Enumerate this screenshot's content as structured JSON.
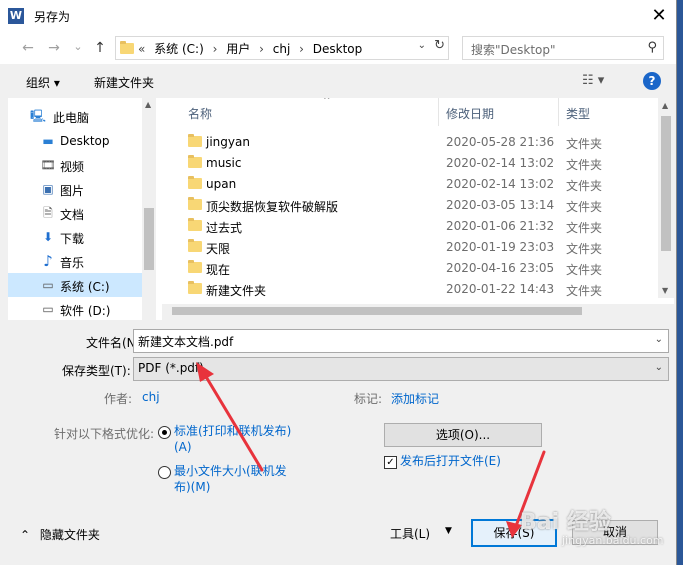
{
  "window": {
    "title": "另存为",
    "app_icon_letter": "W",
    "close_glyph": "✕"
  },
  "nav": {
    "back": "←",
    "forward": "→",
    "recent": "⌄",
    "up": "↑"
  },
  "address": {
    "crumbs": [
      "«",
      "系统 (C:)",
      "›",
      "用户",
      "›",
      "chj",
      "›",
      "Desktop"
    ],
    "dropdown": "⌄",
    "refresh": "↻"
  },
  "search": {
    "placeholder": "搜索\"Desktop\"",
    "icon": "⚲"
  },
  "toolbar": {
    "organize": "组织 ▾",
    "new_folder": "新建文件夹",
    "view_icon": "☷ ▾",
    "help": "?"
  },
  "sidebar": {
    "items": [
      {
        "label": "此电脑",
        "icon": "🖳",
        "selected": false
      },
      {
        "label": "Desktop",
        "icon": "▬",
        "selected": false
      },
      {
        "label": "视频",
        "icon": "🎞",
        "selected": false
      },
      {
        "label": "图片",
        "icon": "▣",
        "selected": false
      },
      {
        "label": "文档",
        "icon": "🗎",
        "selected": false
      },
      {
        "label": "下载",
        "icon": "⬇",
        "selected": false
      },
      {
        "label": "音乐",
        "icon": "♪",
        "selected": false
      },
      {
        "label": "系统 (C:)",
        "icon": "▭",
        "selected": true
      },
      {
        "label": "软件 (D:)",
        "icon": "▭",
        "selected": false
      }
    ]
  },
  "columns": {
    "name": "名称",
    "date": "修改日期",
    "type": "类型",
    "sort_arrow": "^"
  },
  "files": [
    {
      "name": "jingyan",
      "date": "2020-05-28 21:36",
      "type": "文件夹"
    },
    {
      "name": "music",
      "date": "2020-02-14 13:02",
      "type": "文件夹"
    },
    {
      "name": "upan",
      "date": "2020-02-14 13:02",
      "type": "文件夹"
    },
    {
      "name": "顶尖数据恢复软件破解版",
      "date": "2020-03-05 13:14",
      "type": "文件夹"
    },
    {
      "name": "过去式",
      "date": "2020-01-06 21:32",
      "type": "文件夹"
    },
    {
      "name": "天限",
      "date": "2020-01-19 23:03",
      "type": "文件夹"
    },
    {
      "name": "现在",
      "date": "2020-04-16 23:05",
      "type": "文件夹"
    },
    {
      "name": "新建文件夹",
      "date": "2020-01-22 14:43",
      "type": "文件夹"
    }
  ],
  "form": {
    "filename_label": "文件名(N):",
    "filename_value": "新建文本文档.pdf",
    "filetype_label": "保存类型(T):",
    "filetype_value": "PDF (*.pdf)",
    "author_label": "作者:",
    "author_value": "chj",
    "tags_label": "标记:",
    "tags_value": "添加标记",
    "optimize_label": "针对以下格式优化:",
    "option_standard_line1": "标准(打印和联机发布)",
    "option_standard_line2": "(A)",
    "option_minimum_line1": "最小文件大小(联机发",
    "option_minimum_line2": "布)(M)",
    "options_button": "选项(O)...",
    "open_after_publish": "发布后打开文件(E)",
    "open_after_checked": true
  },
  "footer": {
    "hide_folders": "隐藏文件夹",
    "hide_icon": "⌃",
    "tools": "工具(L)",
    "tools_dd": "▼",
    "save": "保存(S)",
    "cancel": "取消"
  },
  "watermark": {
    "main": "Bai 经验",
    "sub": "jingyan.baidu.com"
  },
  "colors": {
    "arrow": "#e8333c",
    "link": "#0066cc",
    "selection": "#cce8ff"
  }
}
